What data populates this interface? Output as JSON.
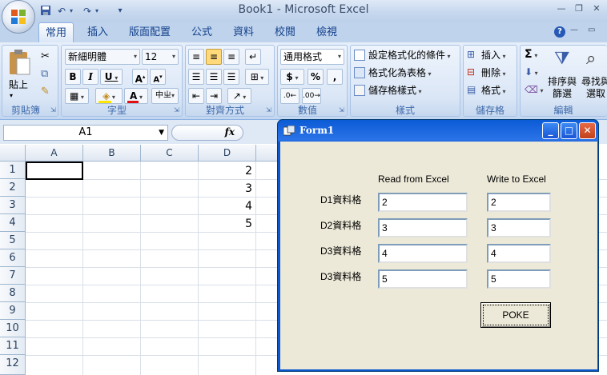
{
  "window": {
    "title": "Book1 - Microsoft Excel"
  },
  "tabs": [
    "常用",
    "插入",
    "版面配置",
    "公式",
    "資料",
    "校閱",
    "檢視"
  ],
  "ribbon": {
    "clipboard": {
      "paste": "貼上",
      "label": "剪貼簿"
    },
    "font": {
      "name": "新細明體",
      "size": "12",
      "label": "字型",
      "bold": "B",
      "italic": "I",
      "underline": "U"
    },
    "alignment": {
      "label": "對齊方式"
    },
    "number": {
      "format": "通用格式",
      "label": "數值",
      "currency": "$",
      "percent": "%",
      "comma": ","
    },
    "styles": {
      "conditional": "設定格式化的條件",
      "table": "格式化為表格",
      "cell": "儲存格樣式",
      "label": "樣式"
    },
    "cells": {
      "insert": "插入",
      "delete": "刪除",
      "format": "格式",
      "label": "儲存格"
    },
    "editing": {
      "sort": "排序與\n篩選",
      "find": "尋找與\n選取",
      "label": "編輯",
      "sigma": "Σ"
    }
  },
  "formula_bar": {
    "name_box": "A1",
    "fx": "fx"
  },
  "sheet": {
    "columns": [
      "A",
      "B",
      "C",
      "D"
    ],
    "rows": [
      "1",
      "2",
      "3",
      "4",
      "5",
      "6",
      "7",
      "8",
      "9",
      "10",
      "11",
      "12"
    ],
    "d_values": [
      "2",
      "3",
      "4",
      "5"
    ]
  },
  "form": {
    "title": "Form1",
    "header_read": "Read from Excel",
    "header_write": "Write to Excel",
    "rows": [
      {
        "label": "D1資料格",
        "read": "2",
        "write": "2"
      },
      {
        "label": "D2資料格",
        "read": "3",
        "write": "3"
      },
      {
        "label": "D3資料格",
        "read": "4",
        "write": "4"
      },
      {
        "label": "D3資料格",
        "read": "5",
        "write": "5"
      }
    ],
    "poke": "POKE"
  }
}
